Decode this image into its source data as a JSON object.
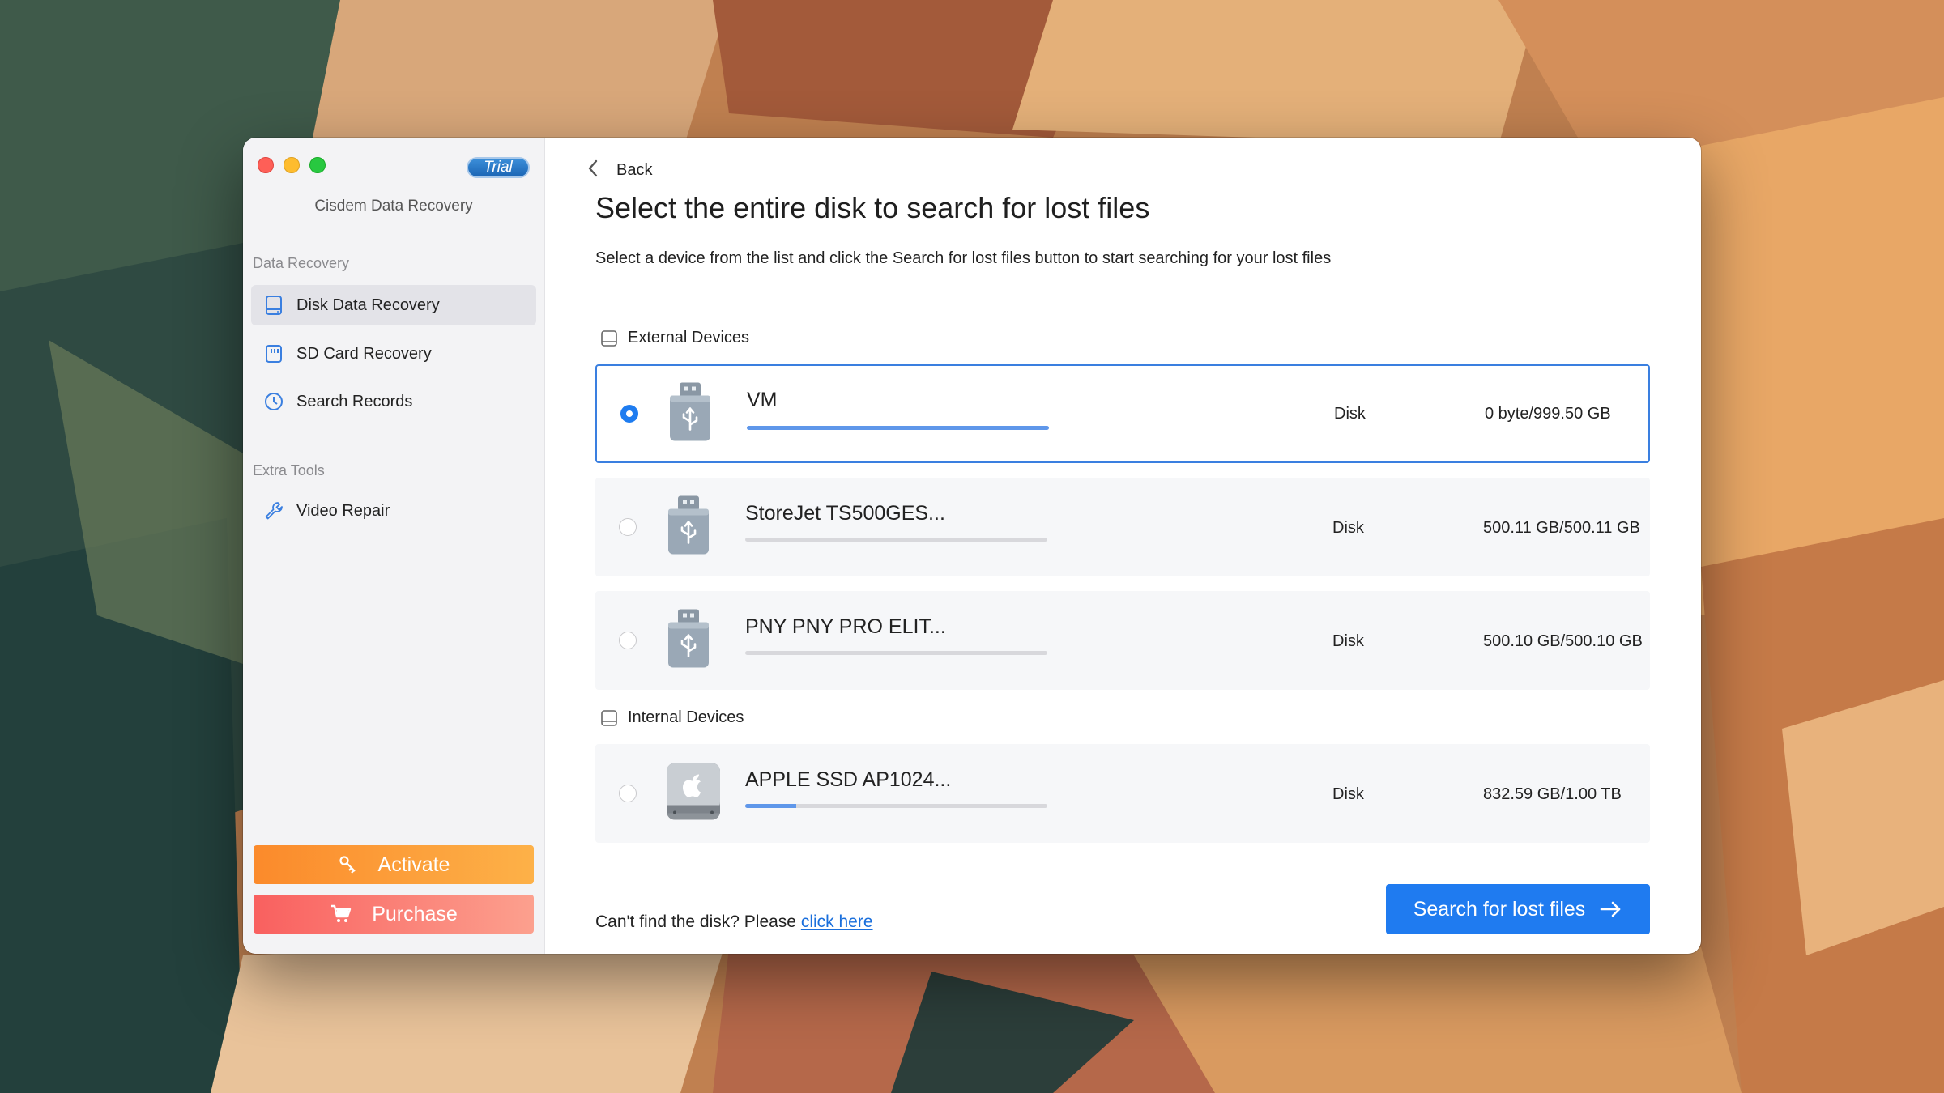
{
  "window": {
    "app_name": "Cisdem Data Recovery",
    "trial_badge": "Trial"
  },
  "sidebar": {
    "sections": [
      {
        "label": "Data Recovery",
        "items": [
          {
            "label": "Disk Data Recovery",
            "icon": "disk-icon",
            "active": true
          },
          {
            "label": "SD Card Recovery",
            "icon": "sd-card-icon"
          },
          {
            "label": "Search Records",
            "icon": "clock-icon"
          }
        ]
      },
      {
        "label": "Extra Tools",
        "items": [
          {
            "label": "Video Repair",
            "icon": "wrench-icon"
          }
        ]
      }
    ],
    "activate_label": "Activate",
    "purchase_label": "Purchase"
  },
  "main": {
    "back_label": "Back",
    "title": "Select the entire disk to search for lost files",
    "subtitle": "Select a device from the list and click the Search for lost files button to start searching for your lost files",
    "external_label": "External Devices",
    "internal_label": "Internal Devices",
    "external_devices": [
      {
        "name": "VM",
        "type": "Disk",
        "size": "0 byte/999.50 GB",
        "usage": 1.0,
        "selected": true
      },
      {
        "name": "StoreJet TS500GES...",
        "type": "Disk",
        "size": "500.11 GB/500.11 GB",
        "usage": 0.0
      },
      {
        "name": "PNY PNY PRO ELIT...",
        "type": "Disk",
        "size": "500.10 GB/500.10 GB",
        "usage": 0.0
      }
    ],
    "internal_devices": [
      {
        "name": "APPLE SSD AP1024...",
        "type": "Disk",
        "size": "832.59 GB/1.00 TB",
        "usage": 0.17
      }
    ],
    "footer_text": "Can't find the disk? Please ",
    "footer_link": "click here",
    "search_button": "Search for lost files"
  },
  "colors": {
    "accent": "#1f7bf0",
    "activate": "#fb8a2b",
    "purchase": "#f9605f"
  }
}
